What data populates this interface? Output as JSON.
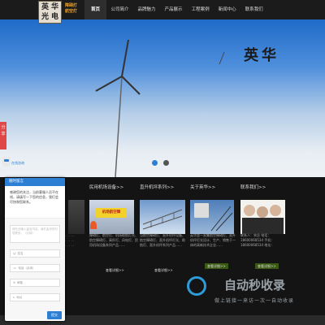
{
  "brand": {
    "logo_text": "英华光电",
    "logo_chars": [
      "英",
      "华",
      "光",
      "电"
    ],
    "sub_line1": "障碍灯",
    "sub_line2": "航空灯"
  },
  "nav": {
    "items": [
      "首页",
      "公司简介",
      "品牌魅力",
      "产品展示",
      "工程案例",
      "新闻中心",
      "联系我们"
    ]
  },
  "banner": {
    "text": "英华",
    "slide_count": 2
  },
  "share": {
    "label": "分享"
  },
  "online": {
    "label": "在线咨询"
  },
  "columns": [
    {
      "title": "",
      "text": "",
      "more": ""
    },
    {
      "title": "民用机场设备>>",
      "text": "障碍灯、航空灯、机场助航灯光、航空障碍灯、高杆灯、风电灯、民用机场设备系列产品……",
      "more": "查看详细>>"
    },
    {
      "title": "直升机坪系列>>",
      "text": "当航空障碍灯、直升机坪设备、航空障碍灯、直升机坪灯光、助航灯、直升机坪系列产品……",
      "more": "查看详细>>"
    },
    {
      "title": "关于英华>>",
      "text": "英华是一家集航空障碍灯、直升机坪灯光设计、生产、销售于一体的高新技术企业……",
      "more": "查看详细>>"
    },
    {
      "title": "联系我们>>",
      "text": "联系人：宋总 电话：18600068534 手机：18600068534 地址：",
      "more": "查看详细>>"
    }
  ],
  "column_image_label": "机场航空障",
  "chat": {
    "title": "随时留言",
    "message": "感谢您的关注，当前客服人员不在线，请填写一下您的信息，我们会尽快和您联系。",
    "textarea_placeholder": "请在此输入留言内容，我们会尽快与您联系。（必填）",
    "fields": [
      "姓名",
      "电话（必填）",
      "邮箱",
      "地址"
    ],
    "send": "提交"
  },
  "watermark": {
    "title": "自动秒收录",
    "subtitle": "做上链接一来访一次一自动收录"
  }
}
